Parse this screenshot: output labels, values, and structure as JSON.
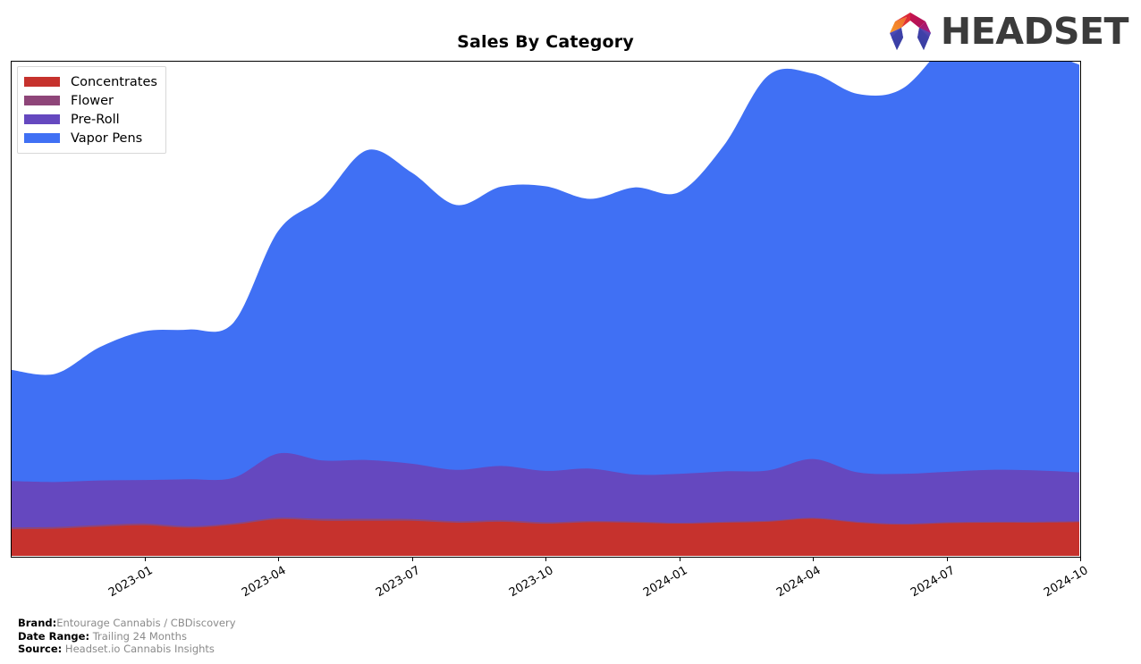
{
  "header": {
    "title": "Sales By Category",
    "logo": {
      "name": "headset-logo",
      "wordmark": "HEADSET",
      "mark_colors": [
        "#f07d26",
        "#e8412e",
        "#c41b45",
        "#a4135f",
        "#7b2fa8",
        "#3b4fc0",
        "#2b3f9e"
      ]
    }
  },
  "legend": {
    "position": "upper-left",
    "items": [
      {
        "label": "Concentrates",
        "color": "#c6322d"
      },
      {
        "label": "Flower",
        "color": "#8e4579"
      },
      {
        "label": "Pre-Roll",
        "color": "#6548bf"
      },
      {
        "label": "Vapor Pens",
        "color": "#4070f4"
      }
    ]
  },
  "footer": {
    "rows": [
      {
        "key": "Brand:",
        "value": "Entourage Cannabis / CBDiscovery",
        "gap": false
      },
      {
        "key": "Date Range:",
        "value": "Trailing 24 Months",
        "gap": true
      },
      {
        "key": "Source:",
        "value": "Headset.io Cannabis Insights",
        "gap": true
      }
    ]
  },
  "chart_data": {
    "type": "area",
    "stacked": true,
    "title": "Sales By Category",
    "xlabel": "",
    "ylabel": "",
    "grid": false,
    "legend_position": "upper-left",
    "smoothing": "spline",
    "y_axis_visible": false,
    "ylim": [
      0,
      100
    ],
    "x": [
      "2022-10",
      "2022-11",
      "2022-12",
      "2023-01",
      "2023-02",
      "2023-03",
      "2023-04",
      "2023-05",
      "2023-06",
      "2023-07",
      "2023-08",
      "2023-09",
      "2023-10",
      "2023-11",
      "2023-12",
      "2024-01",
      "2024-02",
      "2024-03",
      "2024-04",
      "2024-05",
      "2024-06",
      "2024-07",
      "2024-08",
      "2024-09",
      "2024-10"
    ],
    "tick_labels": [
      "2023-01",
      "2023-04",
      "2023-07",
      "2023-10",
      "2024-01",
      "2024-04",
      "2024-07",
      "2024-10"
    ],
    "tick_x": [
      "2023-01",
      "2023-04",
      "2023-07",
      "2023-10",
      "2024-01",
      "2024-04",
      "2024-07",
      "2024-10"
    ],
    "series": [
      {
        "name": "Concentrates",
        "color": "#c6322d",
        "values": [
          5.4,
          5.5,
          5.9,
          6.2,
          5.7,
          6.3,
          7.4,
          7.1,
          7.1,
          7.1,
          6.7,
          6.9,
          6.5,
          6.8,
          6.7,
          6.5,
          6.7,
          6.9,
          7.5,
          6.7,
          6.3,
          6.6,
          6.7,
          6.7,
          6.8
        ]
      },
      {
        "name": "Flower",
        "color": "#8e4579",
        "values": [
          0.35,
          0.35,
          0.35,
          0.35,
          0.3,
          0.3,
          0.3,
          0.4,
          0.4,
          0.35,
          0.3,
          0.3,
          0.3,
          0.25,
          0.25,
          0.2,
          0.2,
          0.2,
          0.2,
          0.2,
          0.2,
          0.2,
          0.2,
          0.2,
          0.2
        ]
      },
      {
        "name": "Pre-Roll",
        "color": "#6548bf",
        "values": [
          9.4,
          9.1,
          9.0,
          8.8,
          9.5,
          9.2,
          13.0,
          11.8,
          11.9,
          11.2,
          10.4,
          11.0,
          10.4,
          10.6,
          9.5,
          9.9,
          10.2,
          10.2,
          11.9,
          10.0,
          10.1,
          10.2,
          10.5,
          10.4,
          9.9
        ]
      },
      {
        "name": "Vapor Pens",
        "color": "#4070f4",
        "values": [
          22.5,
          21.9,
          27.0,
          30.1,
          30.3,
          31.4,
          45.0,
          53.2,
          62.7,
          58.9,
          53.6,
          56.5,
          57.6,
          54.6,
          58.1,
          57.0,
          65.9,
          79.9,
          78.0,
          76.6,
          77.9,
          87.0,
          95.8,
          86.3,
          82.4
        ]
      }
    ],
    "totals": [
      37.65,
      36.85,
      42.25,
      45.45,
      45.8,
      47.2,
      65.7,
      72.5,
      82.1,
      77.55,
      71.0,
      74.7,
      74.8,
      72.25,
      74.55,
      73.6,
      83.0,
      97.2,
      97.6,
      93.5,
      94.5,
      104.0,
      113.2,
      103.6,
      99.3
    ]
  }
}
